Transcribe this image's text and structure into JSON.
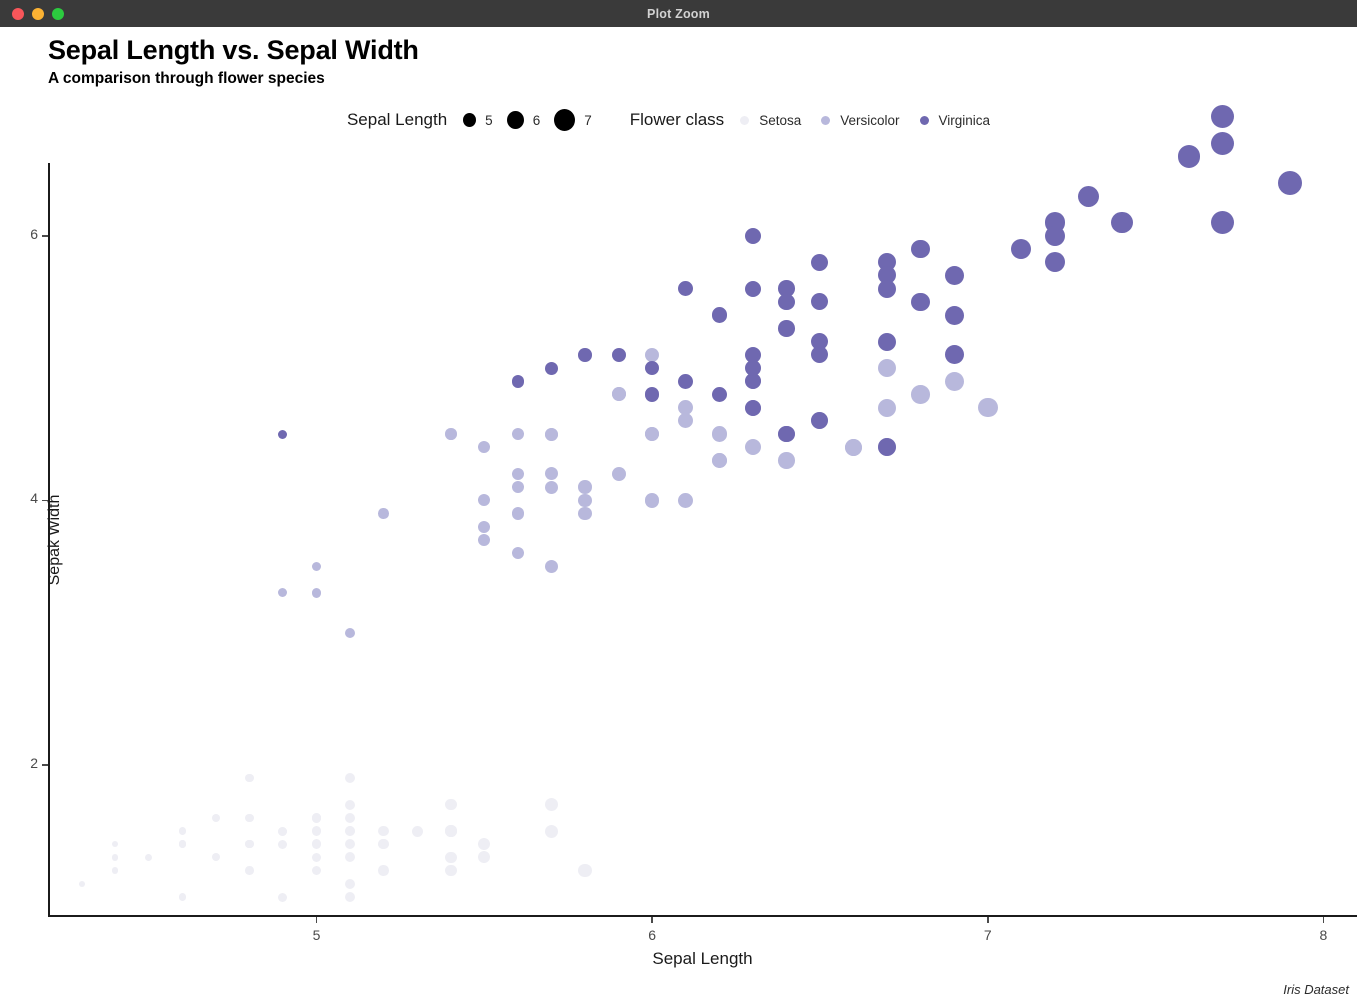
{
  "window": {
    "title": "Plot Zoom",
    "controls": [
      "close",
      "minimize",
      "maximize"
    ]
  },
  "header": {
    "title": "Sepal Length vs. Sepal Width",
    "subtitle": "A comparison through flower species"
  },
  "legends": {
    "size": {
      "title": "Sepal Length",
      "items": [
        {
          "label": "5",
          "size": 13
        },
        {
          "label": "6",
          "size": 17
        },
        {
          "label": "7",
          "size": 21
        }
      ]
    },
    "color": {
      "title": "Flower class",
      "items": [
        {
          "label": "Setosa",
          "color": "#eeeef4"
        },
        {
          "label": "Versicolor",
          "color": "#b8b8dc"
        },
        {
          "label": "Virginica",
          "color": "#6f68b0"
        }
      ]
    }
  },
  "caption": "Iris Dataset",
  "chart_data": {
    "type": "scatter",
    "title": "Sepal Length vs. Sepal Width",
    "subtitle": "A comparison through flower species",
    "xlabel": "Sepal Length",
    "ylabel": "Sepak Width",
    "caption": "Iris Dataset",
    "grid": false,
    "legend_position": "top-center",
    "xlim": [
      4.2,
      8.1
    ],
    "ylim": [
      0.85,
      6.55
    ],
    "xticks": [
      5,
      6,
      7,
      8
    ],
    "yticks": [
      2,
      4,
      6
    ],
    "size_encoding": {
      "field": "Sepal Length",
      "breaks": [
        5,
        6,
        7
      ]
    },
    "color_encoding": {
      "field": "Flower class",
      "categories": [
        "Setosa",
        "Versicolor",
        "Virginica"
      ],
      "colors": [
        "#eeeef4",
        "#b8b8dc",
        "#6f68b0"
      ]
    },
    "series": [
      {
        "name": "Setosa",
        "color": "#eeeef4",
        "points": [
          [
            4.3,
            1.1
          ],
          [
            4.4,
            1.4
          ],
          [
            4.4,
            1.3
          ],
          [
            4.4,
            1.2
          ],
          [
            4.5,
            1.3
          ],
          [
            4.6,
            1.5
          ],
          [
            4.6,
            1.4
          ],
          [
            4.6,
            1.4
          ],
          [
            4.6,
            1.0
          ],
          [
            4.7,
            1.3
          ],
          [
            4.7,
            1.6
          ],
          [
            4.8,
            1.9
          ],
          [
            4.8,
            1.6
          ],
          [
            4.8,
            1.4
          ],
          [
            4.8,
            1.4
          ],
          [
            4.8,
            1.2
          ],
          [
            4.9,
            1.5
          ],
          [
            4.9,
            1.5
          ],
          [
            4.9,
            1.4
          ],
          [
            4.9,
            1.0
          ],
          [
            5.0,
            1.6
          ],
          [
            5.0,
            1.4
          ],
          [
            5.0,
            1.5
          ],
          [
            5.0,
            1.3
          ],
          [
            5.0,
            1.6
          ],
          [
            5.0,
            1.2
          ],
          [
            5.1,
            1.9
          ],
          [
            5.1,
            1.7
          ],
          [
            5.1,
            1.6
          ],
          [
            5.1,
            1.5
          ],
          [
            5.1,
            1.5
          ],
          [
            5.1,
            1.4
          ],
          [
            5.1,
            1.3
          ],
          [
            5.1,
            1.1
          ],
          [
            5.2,
            1.5
          ],
          [
            5.2,
            1.4
          ],
          [
            5.2,
            1.4
          ],
          [
            5.2,
            1.2
          ],
          [
            5.3,
            1.5
          ],
          [
            5.4,
            1.7
          ],
          [
            5.4,
            1.5
          ],
          [
            5.4,
            1.5
          ],
          [
            5.4,
            1.3
          ],
          [
            5.4,
            1.2
          ],
          [
            5.5,
            1.4
          ],
          [
            5.5,
            1.3
          ],
          [
            5.7,
            1.7
          ],
          [
            5.7,
            1.5
          ],
          [
            5.8,
            1.2
          ],
          [
            5.1,
            1.0
          ]
        ]
      },
      {
        "name": "Versicolor",
        "color": "#b8b8dc",
        "points": [
          [
            4.9,
            3.3
          ],
          [
            5.0,
            3.5
          ],
          [
            5.0,
            3.3
          ],
          [
            5.1,
            3.0
          ],
          [
            5.2,
            3.9
          ],
          [
            5.4,
            4.5
          ],
          [
            5.5,
            4.4
          ],
          [
            5.5,
            4.0
          ],
          [
            5.5,
            3.8
          ],
          [
            5.5,
            3.7
          ],
          [
            5.6,
            4.5
          ],
          [
            5.6,
            4.2
          ],
          [
            5.6,
            4.1
          ],
          [
            5.6,
            3.9
          ],
          [
            5.6,
            3.6
          ],
          [
            5.7,
            4.5
          ],
          [
            5.7,
            4.2
          ],
          [
            5.7,
            4.1
          ],
          [
            5.7,
            3.5
          ],
          [
            5.8,
            4.1
          ],
          [
            5.8,
            4.0
          ],
          [
            5.8,
            3.9
          ],
          [
            5.9,
            4.8
          ],
          [
            5.9,
            4.2
          ],
          [
            6.0,
            5.1
          ],
          [
            6.0,
            4.5
          ],
          [
            6.0,
            4.0
          ],
          [
            6.1,
            4.7
          ],
          [
            6.1,
            4.6
          ],
          [
            6.1,
            4.0
          ],
          [
            6.2,
            4.5
          ],
          [
            6.2,
            4.3
          ],
          [
            6.3,
            4.7
          ],
          [
            6.3,
            4.4
          ],
          [
            6.4,
            4.5
          ],
          [
            6.4,
            4.3
          ],
          [
            6.5,
            4.6
          ],
          [
            6.6,
            4.4
          ],
          [
            6.6,
            4.4
          ],
          [
            6.7,
            5.0
          ],
          [
            6.7,
            4.7
          ],
          [
            6.7,
            4.4
          ],
          [
            6.8,
            4.8
          ],
          [
            6.9,
            4.9
          ],
          [
            7.0,
            4.7
          ],
          [
            6.3,
            4.9
          ],
          [
            6.2,
            4.3
          ],
          [
            5.7,
            4.5
          ],
          [
            6.0,
            4.5
          ],
          [
            5.9,
            4.8
          ]
        ]
      },
      {
        "name": "Virginica",
        "color": "#6f68b0",
        "points": [
          [
            4.9,
            4.5
          ],
          [
            5.6,
            4.9
          ],
          [
            5.7,
            5.0
          ],
          [
            5.8,
            5.1
          ],
          [
            5.9,
            5.1
          ],
          [
            6.0,
            4.8
          ],
          [
            6.0,
            5.0
          ],
          [
            6.1,
            4.9
          ],
          [
            6.1,
            5.6
          ],
          [
            6.2,
            4.8
          ],
          [
            6.2,
            5.4
          ],
          [
            6.3,
            6.0
          ],
          [
            6.3,
            5.6
          ],
          [
            6.3,
            4.9
          ],
          [
            6.3,
            5.0
          ],
          [
            6.3,
            5.1
          ],
          [
            6.3,
            4.7
          ],
          [
            6.4,
            5.6
          ],
          [
            6.4,
            5.5
          ],
          [
            6.4,
            5.3
          ],
          [
            6.5,
            5.8
          ],
          [
            6.5,
            5.5
          ],
          [
            6.5,
            5.1
          ],
          [
            6.5,
            5.2
          ],
          [
            6.5,
            4.6
          ],
          [
            6.7,
            5.8
          ],
          [
            6.7,
            5.7
          ],
          [
            6.7,
            5.6
          ],
          [
            6.7,
            5.2
          ],
          [
            6.8,
            5.9
          ],
          [
            6.8,
            5.5
          ],
          [
            6.9,
            5.7
          ],
          [
            6.9,
            5.4
          ],
          [
            6.9,
            5.1
          ],
          [
            7.1,
            5.9
          ],
          [
            7.2,
            6.1
          ],
          [
            7.2,
            6.0
          ],
          [
            7.2,
            5.8
          ],
          [
            7.3,
            6.3
          ],
          [
            7.4,
            6.1
          ],
          [
            7.6,
            6.6
          ],
          [
            7.7,
            6.7
          ],
          [
            7.7,
            6.9
          ],
          [
            7.7,
            6.1
          ],
          [
            7.9,
            6.4
          ],
          [
            6.4,
            4.5
          ],
          [
            6.7,
            4.4
          ]
        ]
      }
    ]
  }
}
